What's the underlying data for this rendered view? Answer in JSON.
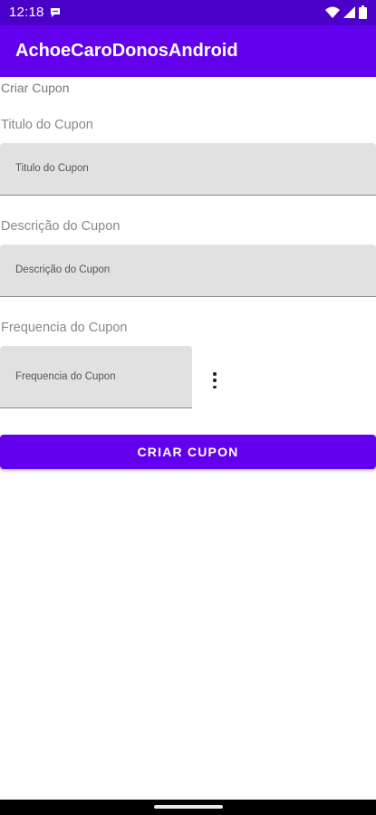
{
  "status_bar": {
    "time": "12:18",
    "icons": [
      "message-bubble-icon",
      "wifi-icon",
      "signal-icon",
      "battery-icon"
    ]
  },
  "app_bar": {
    "title": "AchoeCaroDonosAndroid"
  },
  "page": {
    "heading": "Criar Cupon"
  },
  "form": {
    "titulo": {
      "label": "Titulo do Cupon",
      "placeholder": "Titulo do Cupon",
      "value": ""
    },
    "descricao": {
      "label": "Descrição do Cupon",
      "placeholder": "Descrição do Cupon",
      "value": ""
    },
    "frequencia": {
      "label": "Frequencia do Cupon",
      "placeholder": "Frequencia do Cupon",
      "value": ""
    },
    "submit_label": "CRIAR CUPON"
  },
  "colors": {
    "primary": "#6200ee",
    "status_bar": "#4a00c8",
    "field_bg": "#e1e1e1"
  }
}
